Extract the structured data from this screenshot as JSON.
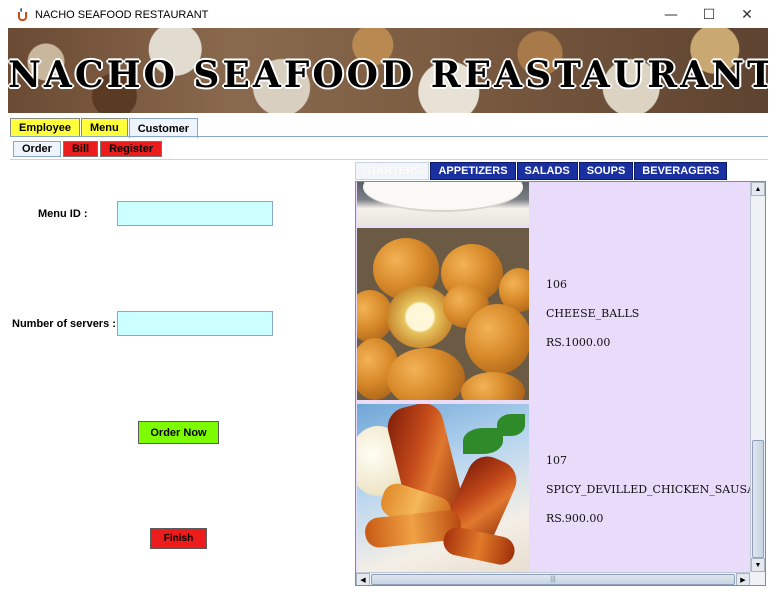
{
  "window": {
    "title": "NACHO SEAFOOD RESTAURANT",
    "minimize": "—",
    "maximize": "☐",
    "close": "✕"
  },
  "banner": {
    "text": "NACHO SEAFOOD REASTAURANT"
  },
  "main_tabs": [
    "Employee",
    "Menu",
    "Customer"
  ],
  "sub_tabs": [
    "Order",
    "Bill",
    "Register"
  ],
  "order_form": {
    "menu_id_label": "Menu ID :",
    "menu_id_value": "",
    "servers_label": "Number of servers :",
    "servers_value": "",
    "order_button": "Order Now",
    "finish_button": "Finish"
  },
  "food_tabs": [
    "STARTERS",
    "APPETIZERS",
    "SALADS",
    "SOUPS",
    "BEVERAGERS"
  ],
  "menu_items": [
    {
      "id": "106",
      "name": "CHEESE_BALLS",
      "price": "RS.1000.00"
    },
    {
      "id": "107",
      "name": "SPICY_DEVILLED_CHICKEN_SAUSAGES",
      "price": "RS.900.00"
    }
  ],
  "scrollbar": {
    "up": "▲",
    "down": "▼",
    "left": "◀",
    "right": "▶",
    "grip": "|||"
  },
  "colors": {
    "tab_yellow": "#ffff3c",
    "tab_red": "#ec1c1c",
    "food_tab_blue": "#1a2fa0",
    "input_bg": "#ccffff",
    "order_button": "#7dfc00",
    "list_bg": "#e9dcfb"
  },
  "icons": {
    "app": "java-cup-icon"
  }
}
